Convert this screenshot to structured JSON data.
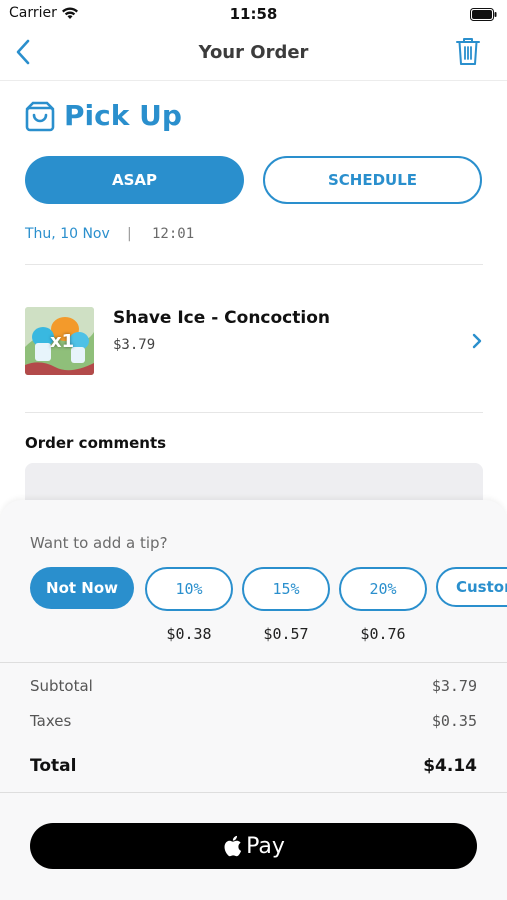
{
  "status_bar": {
    "carrier": "Carrier",
    "time": "11:58"
  },
  "nav": {
    "title": "Your Order"
  },
  "pickup": {
    "title": "Pick Up",
    "asap_label": "ASAP",
    "schedule_label": "SCHEDULE",
    "date": "Thu, 10 Nov",
    "separator": "|",
    "time": "12:01"
  },
  "item": {
    "name": "Shave Ice - Concoction",
    "price": "$3.79",
    "quantity_badge": "x1"
  },
  "comments": {
    "label": "Order comments"
  },
  "tip": {
    "question": "Want to add a tip?",
    "options": [
      {
        "label": "Not Now",
        "amount": ""
      },
      {
        "label": "10%",
        "amount": "$0.38"
      },
      {
        "label": "15%",
        "amount": "$0.57"
      },
      {
        "label": "20%",
        "amount": "$0.76"
      },
      {
        "label": "Custom",
        "amount": ""
      }
    ],
    "selected": "Not Now"
  },
  "summary": {
    "subtotal_label": "Subtotal",
    "subtotal_value": "$3.79",
    "taxes_label": "Taxes",
    "taxes_value": "$0.35",
    "total_label": "Total",
    "total_value": "$4.14"
  },
  "pay": {
    "label": "Pay"
  },
  "colors": {
    "accent": "#2a8fcd",
    "pay_button": "#000000"
  }
}
